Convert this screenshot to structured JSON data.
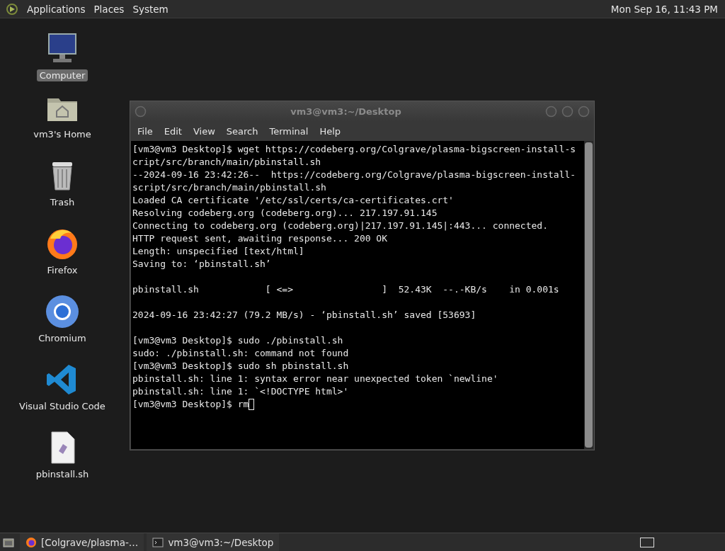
{
  "top_panel": {
    "menus": [
      "Applications",
      "Places",
      "System"
    ],
    "clock": "Mon Sep 16, 11:43 PM"
  },
  "desktop_icons": [
    {
      "label": "Computer",
      "kind": "computer",
      "selected": true
    },
    {
      "label": "vm3's Home",
      "kind": "home",
      "selected": false
    },
    {
      "label": "Trash",
      "kind": "trash",
      "selected": false
    },
    {
      "label": "Firefox",
      "kind": "firefox",
      "selected": false
    },
    {
      "label": "Chromium",
      "kind": "chromium",
      "selected": false
    },
    {
      "label": "Visual Studio Code",
      "kind": "vscode",
      "selected": false
    },
    {
      "label": "pbinstall.sh",
      "kind": "script",
      "selected": false
    }
  ],
  "terminal": {
    "title": "vm3@vm3:~/Desktop",
    "menu": [
      "File",
      "Edit",
      "View",
      "Search",
      "Terminal",
      "Help"
    ],
    "cursor": true,
    "blocks": [
      [
        "[vm3@vm3 Desktop]$ wget https://codeberg.org/Colgrave/plasma-bigscreen-install-s",
        "cript/src/branch/main/pbinstall.sh",
        "--2024-09-16 23:42:26--  https://codeberg.org/Colgrave/plasma-bigscreen-install-",
        "script/src/branch/main/pbinstall.sh",
        "Loaded CA certificate '/etc/ssl/certs/ca-certificates.crt'",
        "Resolving codeberg.org (codeberg.org)... 217.197.91.145",
        "Connecting to codeberg.org (codeberg.org)|217.197.91.145|:443... connected.",
        "HTTP request sent, awaiting response... 200 OK",
        "Length: unspecified [text/html]",
        "Saving to: ‘pbinstall.sh’"
      ],
      [
        "pbinstall.sh            [ <=>                ]  52.43K  --.-KB/s    in 0.001s"
      ],
      [
        "2024-09-16 23:42:27 (79.2 MB/s) - ‘pbinstall.sh’ saved [53693]"
      ],
      [
        "[vm3@vm3 Desktop]$ sudo ./pbinstall.sh",
        "sudo: ./pbinstall.sh: command not found",
        "[vm3@vm3 Desktop]$ sudo sh pbinstall.sh",
        "pbinstall.sh: line 1: syntax error near unexpected token `newline'",
        "pbinstall.sh: line 1: `<!DOCTYPE html>'",
        "[vm3@vm3 Desktop]$ rm"
      ]
    ]
  },
  "taskbar": {
    "tasks": [
      {
        "label": "[Colgrave/plasma-…",
        "kind": "browser"
      },
      {
        "label": "vm3@vm3:~/Desktop",
        "kind": "terminal"
      }
    ]
  }
}
